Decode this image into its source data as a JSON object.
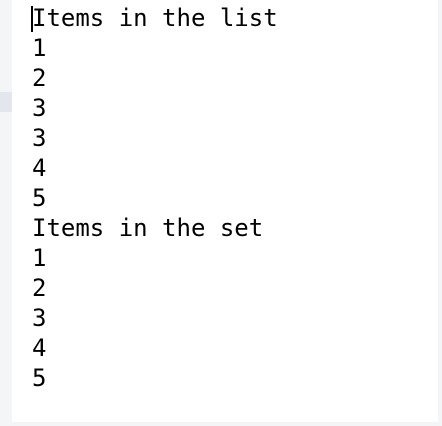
{
  "console": {
    "lines": [
      "Items in the list",
      "1",
      "2",
      "3",
      "3",
      "4",
      "5",
      "Items in the set",
      "1",
      "2",
      "3",
      "4",
      "5"
    ]
  },
  "colors": {
    "background": "#ffffff",
    "text": "#000000",
    "gutter": "#f4f5f7"
  }
}
